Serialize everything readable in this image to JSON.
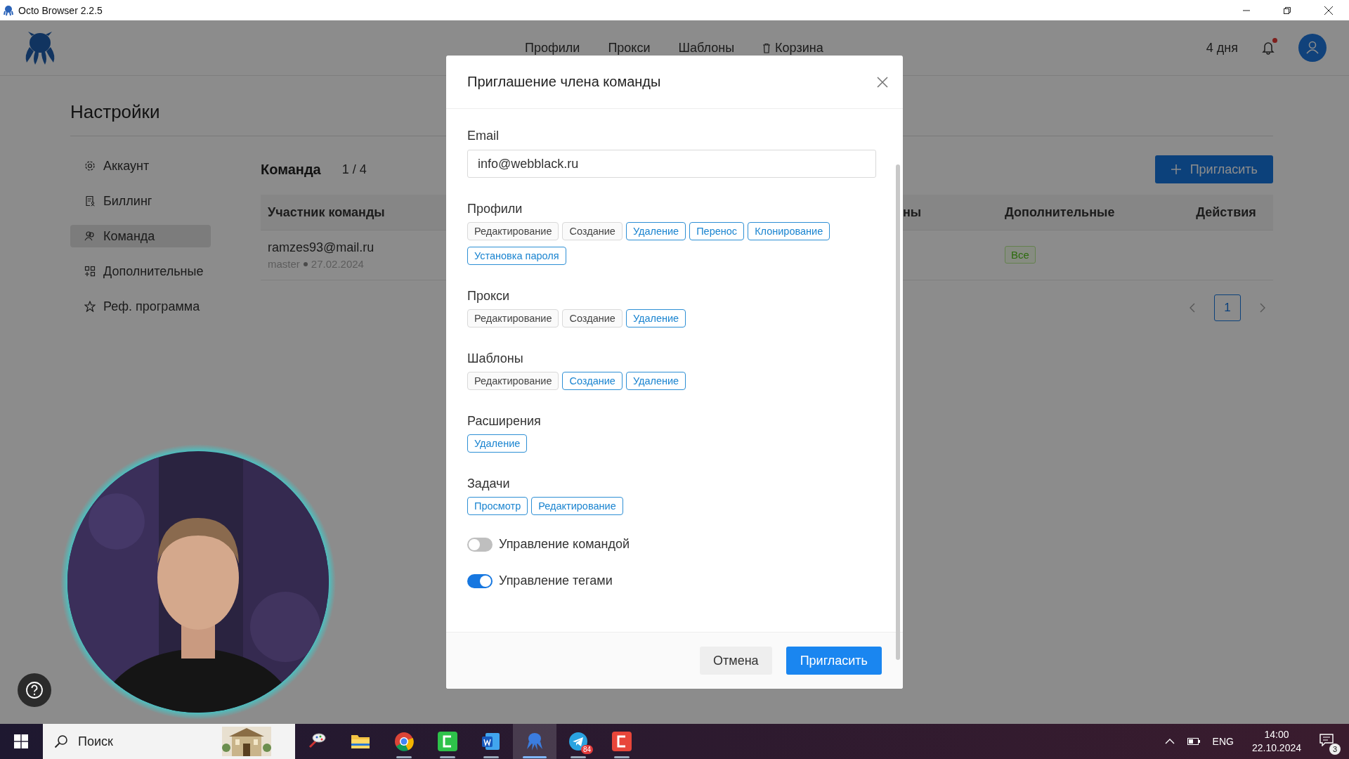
{
  "window": {
    "title": "Octo Browser 2.2.5"
  },
  "nav": {
    "items": [
      {
        "label": "Профили",
        "kind": "link"
      },
      {
        "label": "Прокси",
        "kind": "link"
      },
      {
        "label": "Шаблоны",
        "kind": "link"
      },
      {
        "label": "Корзина",
        "kind": "trash"
      }
    ],
    "subscription": "4 дня",
    "unread": true
  },
  "settings": {
    "title": "Настройки",
    "menu": [
      {
        "label": "Аккаунт",
        "selected": false
      },
      {
        "label": "Биллинг",
        "selected": false
      },
      {
        "label": "Команда",
        "selected": true
      },
      {
        "label": "Дополнительные",
        "selected": false
      },
      {
        "label": "Реф. программа",
        "selected": false
      }
    ]
  },
  "team": {
    "title": "Команда",
    "count": "1 / 4",
    "invite_button": "Пригласить",
    "columns": [
      "Участник команды",
      "ны",
      "Дополнительные",
      "Действия"
    ],
    "rows": [
      {
        "email": "ramzes93@mail.ru",
        "role": "master",
        "date": "27.02.2024",
        "extra": "Все"
      }
    ],
    "pages": [
      {
        "label": "1",
        "selected": true
      }
    ]
  },
  "modal": {
    "title": "Приглашение члена команды",
    "email": {
      "label": "Email",
      "value": "info@webblack.ru"
    },
    "groups": [
      {
        "title": "Профили",
        "tags": [
          {
            "label": "Редактирование",
            "selected": false
          },
          {
            "label": "Создание",
            "selected": false
          },
          {
            "label": "Удаление",
            "selected": true
          },
          {
            "label": "Перенос",
            "selected": true
          },
          {
            "label": "Клонирование",
            "selected": true
          },
          {
            "label": "Установка пароля",
            "selected": true
          }
        ]
      },
      {
        "title": "Прокси",
        "tags": [
          {
            "label": "Редактирование",
            "selected": false
          },
          {
            "label": "Создание",
            "selected": false
          },
          {
            "label": "Удаление",
            "selected": true
          }
        ]
      },
      {
        "title": "Шаблоны",
        "tags": [
          {
            "label": "Редактирование",
            "selected": false
          },
          {
            "label": "Создание",
            "selected": true
          },
          {
            "label": "Удаление",
            "selected": true
          }
        ]
      },
      {
        "title": "Расширения",
        "tags": [
          {
            "label": "Удаление",
            "selected": true
          }
        ]
      },
      {
        "title": "Задачи",
        "tags": [
          {
            "label": "Просмотр",
            "selected": true
          },
          {
            "label": "Редактирование",
            "selected": true
          }
        ]
      }
    ],
    "switches": [
      {
        "label": "Управление командой",
        "on": false
      },
      {
        "label": "Управление тегами",
        "on": true
      }
    ],
    "buttons": [
      {
        "label": "Отмена",
        "kind": "default"
      },
      {
        "label": "Пригласить",
        "kind": "primary"
      }
    ]
  },
  "taskbar": {
    "search_placeholder": "Поиск",
    "apps": [
      {
        "running": false,
        "active": false
      },
      {
        "running": false,
        "active": false
      },
      {
        "running": true,
        "active": false
      },
      {
        "running": true,
        "active": false
      },
      {
        "running": true,
        "active": false
      },
      {
        "running": true,
        "active": true
      },
      {
        "running": true,
        "active": false,
        "badge": "84"
      },
      {
        "running": true,
        "active": false
      }
    ],
    "language": "ENG",
    "time": "14:00",
    "date": "22.10.2024",
    "notifications": "3"
  }
}
